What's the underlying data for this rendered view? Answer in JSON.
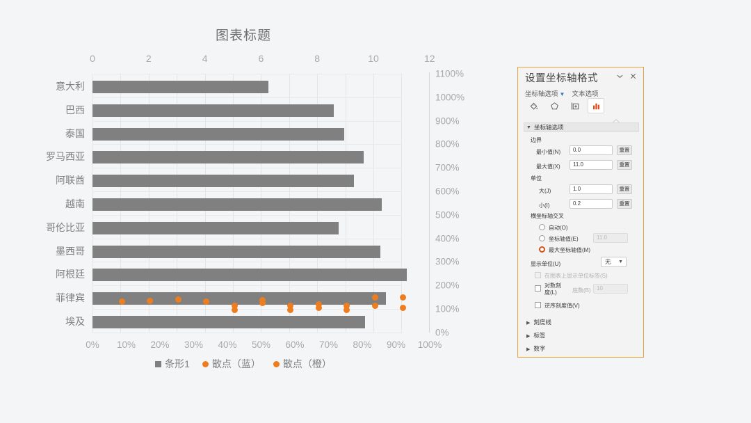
{
  "chart_data": {
    "type": "bar",
    "title": "图表标题",
    "xlabel": "",
    "ylabel": "",
    "categories": [
      "意大利",
      "巴西",
      "泰国",
      "罗马西亚",
      "阿联酋",
      "越南",
      "哥伦比亚",
      "墨西哥",
      "阿根廷",
      "菲律宾",
      "埃及"
    ],
    "series": [
      {
        "name": "条形1",
        "type": "bar",
        "color": "#808080",
        "values": [
          6.25,
          8.6,
          8.95,
          9.65,
          9.3,
          10.3,
          8.75,
          10.25,
          11.2,
          10.45,
          9.7
        ]
      },
      {
        "name": "散点（蓝）",
        "type": "scatter",
        "color": "#ed7d1f",
        "points": [
          {
            "x": 1.05,
            "y": 130
          },
          {
            "x": 2.05,
            "y": 135
          },
          {
            "x": 3.05,
            "y": 140
          },
          {
            "x": 4.05,
            "y": 132
          },
          {
            "x": 5.05,
            "y": 112
          },
          {
            "x": 6.05,
            "y": 138
          },
          {
            "x": 7.05,
            "y": 112
          },
          {
            "x": 8.05,
            "y": 120
          },
          {
            "x": 9.05,
            "y": 112
          },
          {
            "x": 10.05,
            "y": 148
          },
          {
            "x": 11.05,
            "y": 150
          }
        ]
      },
      {
        "name": "散点（橙）",
        "type": "scatter",
        "color": "#ed7d1f",
        "points": [
          {
            "x": 5.05,
            "y": 96
          },
          {
            "x": 6.05,
            "y": 124
          },
          {
            "x": 7.05,
            "y": 96
          },
          {
            "x": 8.05,
            "y": 104
          },
          {
            "x": 9.05,
            "y": 96
          },
          {
            "x": 10.05,
            "y": 114
          },
          {
            "x": 11.05,
            "y": 104
          }
        ]
      }
    ],
    "top_axis": {
      "ticks": [
        "0",
        "2",
        "4",
        "6",
        "8",
        "10",
        "12"
      ],
      "values": [
        0,
        2,
        4,
        6,
        8,
        10,
        12
      ],
      "min": 0,
      "max": 12
    },
    "bottom_axis": {
      "ticks": [
        "0%",
        "10%",
        "20%",
        "30%",
        "40%",
        "50%",
        "60%",
        "70%",
        "80%",
        "90%",
        "100%"
      ],
      "values": [
        0,
        10,
        20,
        30,
        40,
        50,
        60,
        70,
        80,
        90,
        100
      ]
    },
    "right_axis": {
      "ticks": [
        "1100%",
        "1000%",
        "900%",
        "800%",
        "700%",
        "600%",
        "500%",
        "400%",
        "300%",
        "200%",
        "100%",
        "0%"
      ],
      "values": [
        1100,
        1000,
        900,
        800,
        700,
        600,
        500,
        400,
        300,
        200,
        100,
        0
      ],
      "min": 0,
      "max": 1100
    },
    "grid": true,
    "legend_position": "bottom"
  },
  "panel": {
    "title": "设置坐标轴格式",
    "collapse_icon": "chevron-down-icon",
    "close_icon": "close-icon",
    "tabs": [
      {
        "label": "坐标轴选项",
        "has_caret": true
      },
      {
        "label": "文本选项",
        "has_caret": false
      }
    ],
    "icon_tabs": [
      {
        "name": "fill-icon",
        "active": false
      },
      {
        "name": "effects-icon",
        "active": false
      },
      {
        "name": "size-properties-icon",
        "active": false
      },
      {
        "name": "chart-options-icon",
        "active": true
      }
    ],
    "section": {
      "header": "坐标轴选项",
      "bounds_label": "边界",
      "min_label": "最小值(N)",
      "min_value": "0.0",
      "min_reset": "重置",
      "max_label": "最大值(X)",
      "max_value": "11.0",
      "max_reset": "重置",
      "units_label": "单位",
      "major_label": "大(J)",
      "major_value": "1.0",
      "major_reset": "重置",
      "minor_label": "小(I)",
      "minor_value": "0.2",
      "minor_reset": "重置",
      "cross_label": "横坐标轴交叉",
      "radio_auto": "自动(O)",
      "radio_axis_value": "坐标轴值(E)",
      "axis_value_input": "11.0",
      "radio_max_axis": "最大坐标轴值(M)",
      "selected_radio": "最大坐标轴值(M)",
      "display_units_label": "显示单位(U)",
      "display_units_value": "无",
      "show_unit_label_checkbox": "在图表上显示单位标签(S)",
      "log_scale_checkbox": "对数刻度(L)",
      "log_base_label": "底数(B)",
      "log_base_value": "10",
      "reverse_checkbox": "逆序刻度值(V)"
    },
    "subsections": [
      {
        "label": "刻度线"
      },
      {
        "label": "标签"
      },
      {
        "label": "数字"
      }
    ]
  },
  "colors": {
    "bar": "#808080",
    "scatter": "#ed7d1f",
    "panel_border": "#e8a33d",
    "accent": "#d94f12",
    "background": "#f4f5f6"
  }
}
